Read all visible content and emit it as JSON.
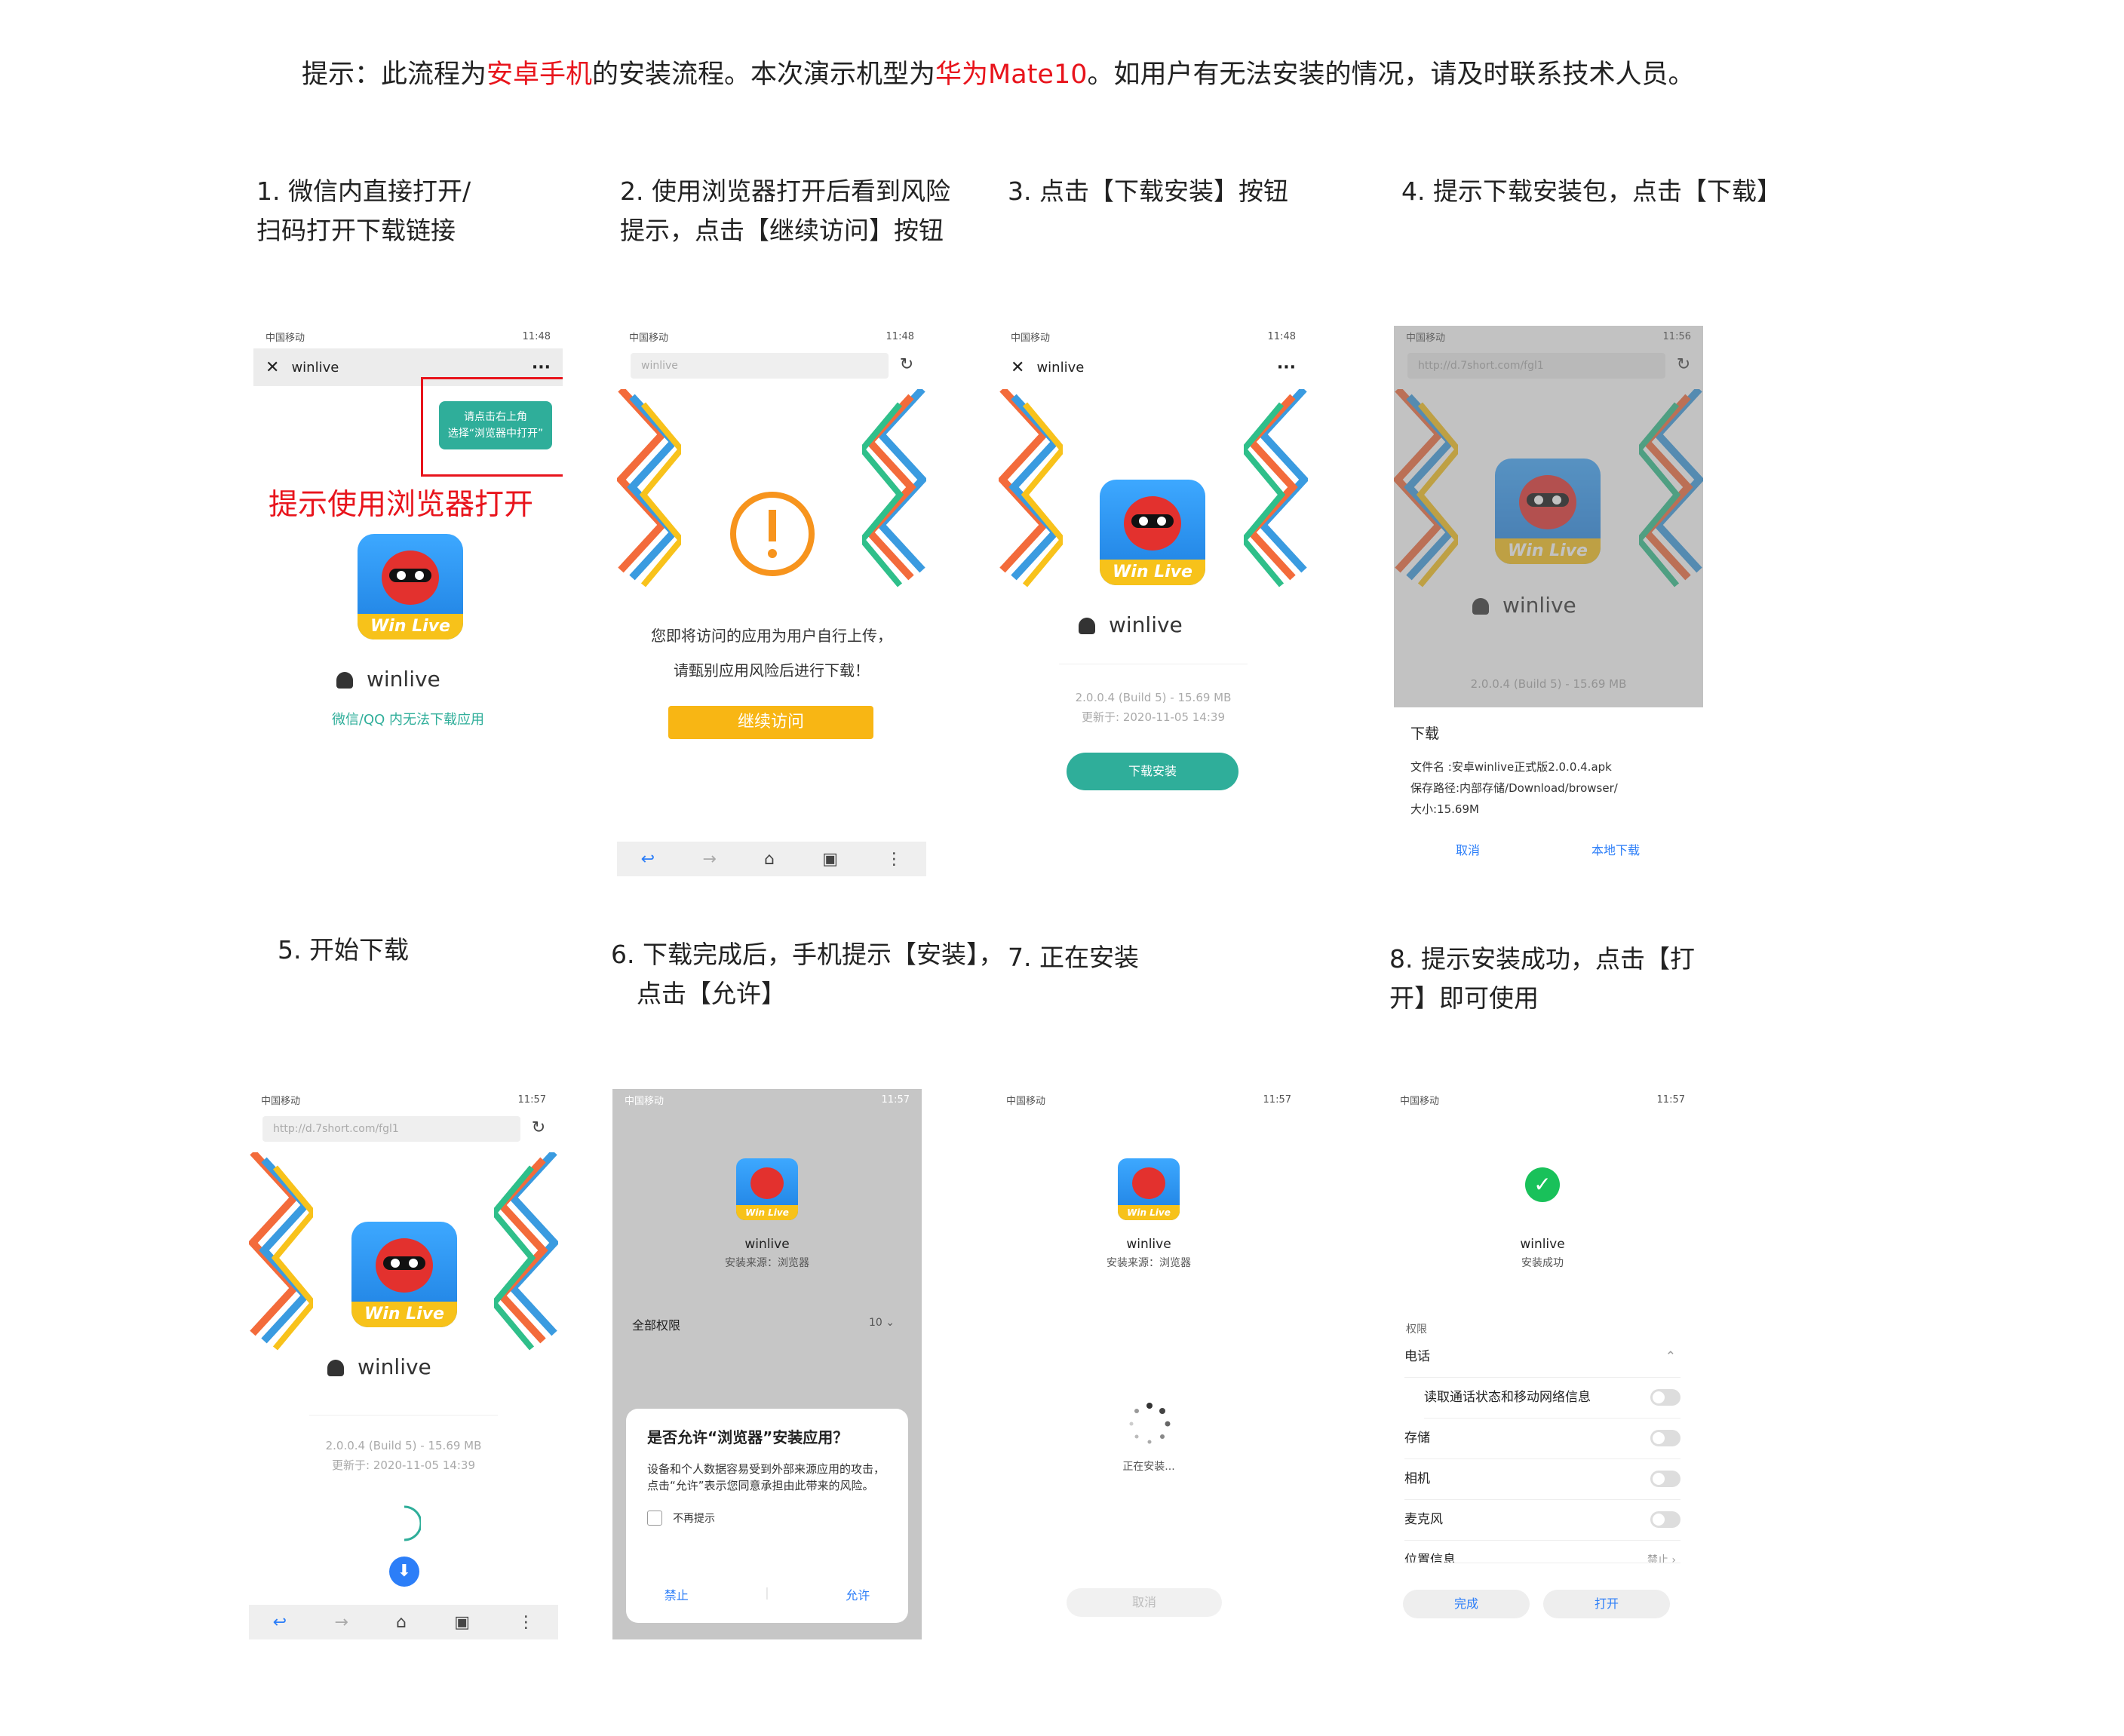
{
  "notice": {
    "prefix": "提示：此流程为",
    "highlight1": "安卓手机",
    "mid1": "的安装流程。本次演示机型为",
    "highlight2": "华为Mate10",
    "suffix": "。如用户有无法安装的情况，请及时联系技术人员。"
  },
  "steps": [
    {
      "line1": "1. 微信内直接打开/",
      "line2": "扫码打开下载链接"
    },
    {
      "line1": "2. 使用浏览器打开后看到风险",
      "line2": "提示，点击【继续访问】按钮"
    },
    {
      "line1": "3. 点击【下载安装】按钮",
      "line2": ""
    },
    {
      "line1": "4. 提示下载安装包，点击【下载】",
      "line2": ""
    },
    {
      "line1": "5. 开始下载",
      "line2": ""
    },
    {
      "line1": "6. 下载完成后，手机提示【安装】，",
      "line2": "点击【允许】"
    },
    {
      "line1": "7. 正在安装",
      "line2": ""
    },
    {
      "line1": "8. 提示安装成功，点击【打",
      "line2": "开】即可使用"
    }
  ],
  "phone": {
    "carrier": "中国移动",
    "time_a": "11:48",
    "time_b": "11:56",
    "time_c": "11:57",
    "url": "http://d.7short.com/fgl1",
    "url_short": "winlive"
  },
  "app": {
    "name": "winlive",
    "badge": "Win Live",
    "version": "2.0.0.4 (Build 5) - 15.69 MB",
    "updated": "更新于: 2020-11-05 14:39"
  },
  "shot1": {
    "wx_title": "winlive",
    "tooltip_line1": "请点击右上角",
    "tooltip_line2": "选择“浏览器中打开”",
    "hint": "提示使用浏览器打开",
    "note": "微信/QQ 内无法下载应用"
  },
  "shot2": {
    "warn_line1": "您即将访问的应用为用户自行上传，",
    "warn_line2": "请甄别应用风险后进行下载！",
    "continue_label": "继续访问"
  },
  "shot3": {
    "wx_title": "winlive",
    "download_label": "下载安装"
  },
  "shot4": {
    "dialog_title": "下载",
    "file_name": "文件名 :安卓winlive正式版2.0.0.4.apk",
    "save_path": "保存路径:内部存储/Download/browser/",
    "size": "大小:15.69M",
    "cancel_label": "取消",
    "local_label": "本地下载"
  },
  "shot6": {
    "source": "安装来源：浏览器",
    "all_perms": "全部权限",
    "perm_count": "10",
    "dialog_title": "是否允许“浏览器”安装应用？",
    "dialog_body": "设备和个人数据容易受到外部来源应用的攻击，点击“允许”表示您同意承担由此带来的风险。",
    "no_remind": "不再提示",
    "deny_label": "禁止",
    "allow_label": "允许"
  },
  "shot7": {
    "source": "安装来源：浏览器",
    "installing": "正在安装...",
    "cancel_label": "取消"
  },
  "shot8": {
    "status": "安装成功",
    "perm_header": "权限",
    "phone": "电话",
    "phone_sub": "读取通话状态和移动网络信息",
    "storage": "存储",
    "camera": "相机",
    "mic": "麦克风",
    "location": "位置信息",
    "location_val": "禁止",
    "done_label": "完成",
    "open_label": "打开"
  },
  "colors": {
    "accent_red": "#e8141c",
    "teal": "#2fae9a",
    "orange": "#f7941d",
    "yellow": "#f8b614",
    "blue": "#2c7ef8",
    "green": "#19c15a"
  }
}
